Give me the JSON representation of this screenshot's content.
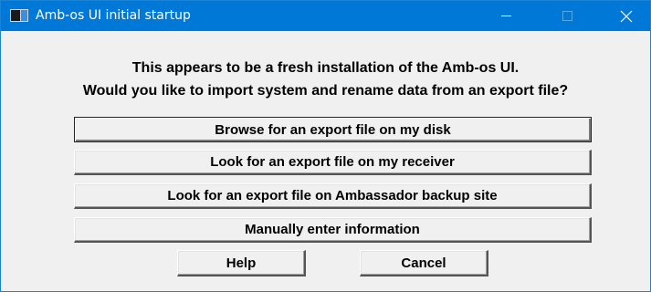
{
  "window": {
    "title": "Amb-os UI initial startup"
  },
  "message": {
    "line1": "This appears to be a fresh installation of the Amb-os UI.",
    "line2": "Would you like to import system and rename data from an export file?"
  },
  "options": {
    "browse_disk": "Browse for an export file on my disk",
    "receiver": "Look for an export file on my receiver",
    "backup_site": "Look for an export file on Ambassador backup site",
    "manual": "Manually enter information"
  },
  "footer": {
    "help": "Help",
    "cancel": "Cancel"
  },
  "colors": {
    "titlebar": "#0078d7",
    "dialog_background": "#f0f0f0"
  },
  "icons": [
    "app-icon",
    "minimize-icon",
    "maximize-icon",
    "close-icon"
  ]
}
